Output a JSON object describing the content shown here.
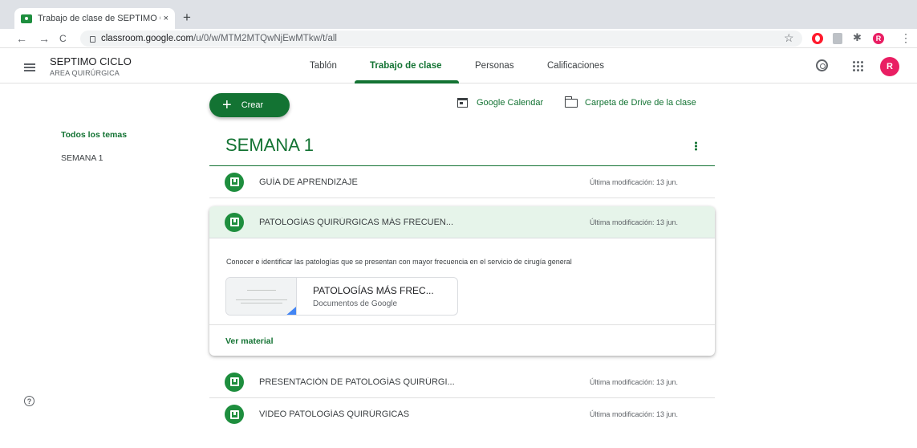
{
  "browser": {
    "tab_title": "Trabajo de clase de SEPTIMO C",
    "tab_close": "×",
    "new_tab": "+",
    "url_host": "classroom.google.com",
    "url_path": "/u/0/w/MTM2MTQwNjEwMTkw/t/all",
    "back": "←",
    "forward": "→",
    "reload": "C",
    "star": "☆",
    "profile_initial": "R",
    "menu": "⋮"
  },
  "header": {
    "class_name": "SEPTIMO CICLO",
    "class_section": "AREA QUIRÚRGICA",
    "tabs": [
      {
        "label": "Tablón"
      },
      {
        "label": "Trabajo de clase"
      },
      {
        "label": "Personas"
      },
      {
        "label": "Calificaciones"
      }
    ],
    "active_tab": "Trabajo de clase",
    "avatar_initial": "R"
  },
  "topics_nav": {
    "items": [
      {
        "label": "Todos los temas"
      },
      {
        "label": "SEMANA 1"
      }
    ]
  },
  "toolbar": {
    "create_label": "Crear",
    "create_plus": "+",
    "calendar_link": "Google Calendar",
    "drive_link": "Carpeta de Drive de la clase"
  },
  "topic": {
    "title": "SEMANA 1",
    "items": [
      {
        "title": "GUÍA DE APRENDIZAJE",
        "date": "Última modificación: 13 jun."
      },
      {
        "title": "PATOLOGÍAS QUIRÚRGICAS MÁS FRECUEN...",
        "date": "Última modificación: 13 jun.",
        "description": "Conocer e identificar las patologías que se presentan con mayor frecuencia en el servicio de cirugía general",
        "attachment_title": "PATOLOGÍAS MÁS FREC...",
        "attachment_type": "Documentos de Google",
        "view_label": "Ver material"
      },
      {
        "title": "PRESENTACIÓN DE PATOLOGÍAS QUIRÚRGI...",
        "date": "Última modificación: 13 jun."
      },
      {
        "title": "VIDEO PATOLOGÍAS QUIRÚRGICAS",
        "date": "Última modificación: 13 jun."
      }
    ]
  },
  "help_glyph": "?",
  "colors": {
    "accent": "#137333",
    "item_icon": "#1e8e3e",
    "selected_bg": "#e6f4ea",
    "avatar": "#e91e63"
  }
}
